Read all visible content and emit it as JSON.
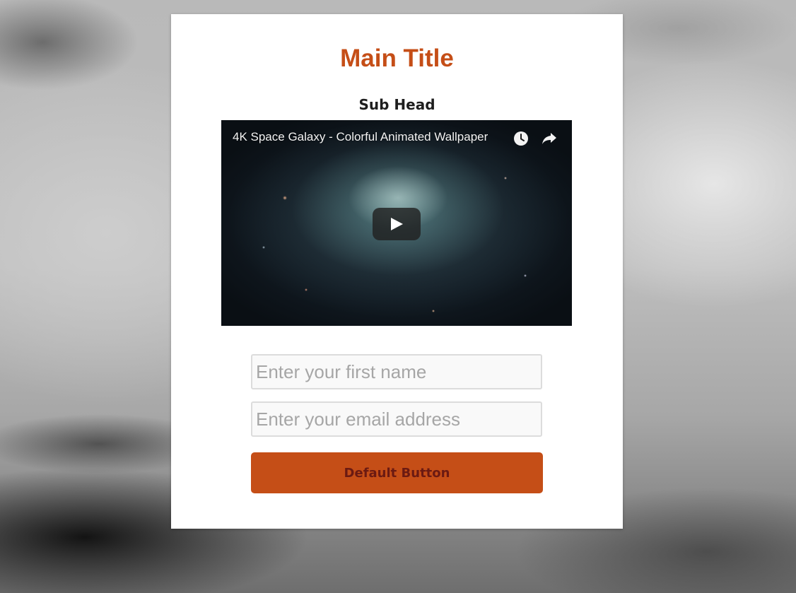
{
  "page": {
    "background_color": "#b9b9b9"
  },
  "card": {
    "title": "Main Title",
    "subhead": "Sub Head",
    "accent_color": "#c54e17"
  },
  "video": {
    "title": "4K Space Galaxy - Colorful Animated Wallpaper",
    "icons": [
      "watch-later-icon",
      "share-icon",
      "play-icon"
    ]
  },
  "form": {
    "first_name_placeholder": "Enter your first name",
    "email_placeholder": "Enter your email address",
    "button_label": "Default Button",
    "button_color": "#c54e17",
    "button_text_color": "#6b1a12"
  }
}
